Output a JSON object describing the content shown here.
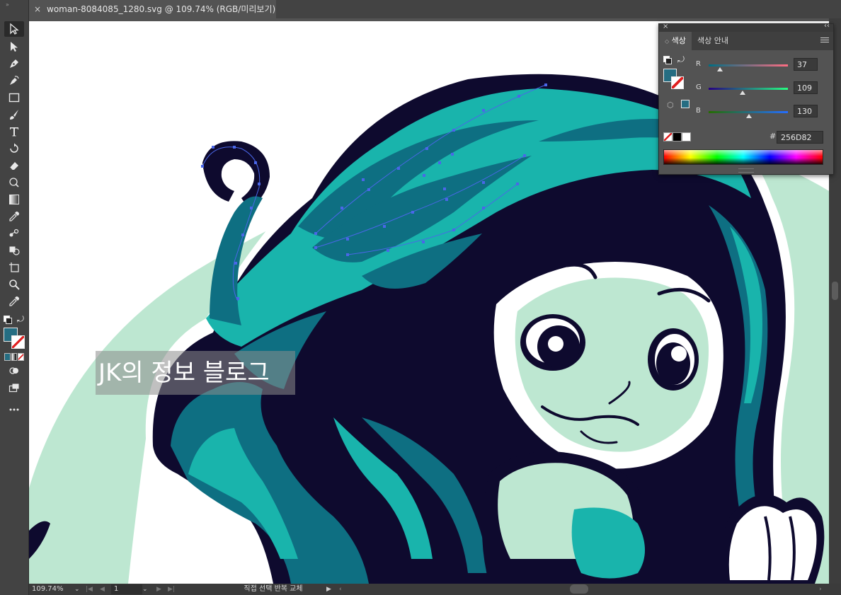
{
  "document": {
    "tab_title": "woman-8084085_1280.svg @ 109.74% (RGB/미리보기)",
    "close_glyph": "×"
  },
  "tools": [
    {
      "name": "selection-tool",
      "active": true
    },
    {
      "name": "direct-selection-tool"
    },
    {
      "name": "pen-tool"
    },
    {
      "name": "curvature-tool"
    },
    {
      "name": "rectangle-tool"
    },
    {
      "name": "paintbrush-tool"
    },
    {
      "name": "type-tool"
    },
    {
      "name": "rotate-tool"
    },
    {
      "name": "eraser-tool"
    },
    {
      "name": "puppet-warp-tool"
    },
    {
      "name": "gradient-tool"
    },
    {
      "name": "eyedropper-tool"
    },
    {
      "name": "blend-tool"
    },
    {
      "name": "shape-builder-tool"
    },
    {
      "name": "artboard-tool"
    },
    {
      "name": "zoom-tool"
    },
    {
      "name": "eyedropper-tool-2"
    }
  ],
  "color_panel": {
    "tabs": [
      "색상",
      "색상 안내"
    ],
    "channels": [
      {
        "label": "R",
        "value": "37",
        "fraction": 0.145
      },
      {
        "label": "G",
        "value": "109",
        "fraction": 0.427
      },
      {
        "label": "B",
        "value": "130",
        "fraction": 0.51
      }
    ],
    "hash_label": "#",
    "hex": "256D82",
    "fill_color": "#256D82",
    "stroke": "none"
  },
  "status_bar": {
    "zoom": "109.74%",
    "page": "1",
    "status_text": "직접 선택 반복 교체"
  },
  "watermark": "JK의 정보 블로그",
  "colors": {
    "chrome_dark": "#434343",
    "chrome": "#535353",
    "art_teal": "#19B4AC",
    "art_dark_teal": "#0E6F82",
    "art_navy": "#0E0A2E",
    "art_mint": "#BDE7D1",
    "anchor_blue": "#4A67E8"
  }
}
